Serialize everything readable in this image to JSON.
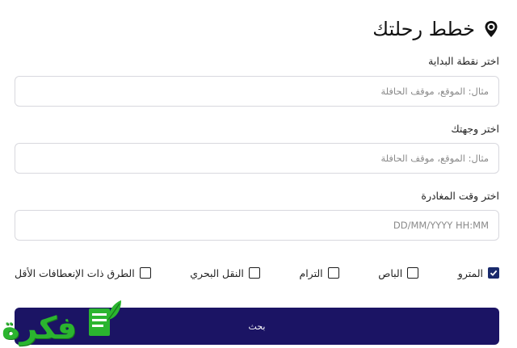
{
  "header": {
    "title": "خطط رحلتك",
    "icon": "location-pin-icon"
  },
  "form": {
    "start": {
      "label": "اختر نقطة البداية",
      "placeholder": "مثال: الموقع، موقف الحافلة",
      "value": ""
    },
    "destination": {
      "label": "اختر وجهتك",
      "placeholder": "مثال: الموقع، موقف الحافلة",
      "value": ""
    },
    "departure": {
      "label": "اختر وقت المغادرة",
      "placeholder": "DD/MM/YYYY HH:MM",
      "value": ""
    }
  },
  "options": [
    {
      "label": "المترو",
      "checked": true
    },
    {
      "label": "الباص",
      "checked": false
    },
    {
      "label": "الترام",
      "checked": false
    },
    {
      "label": "النقل البحري",
      "checked": false
    },
    {
      "label": "الطرق ذات الإنعطافات الأقل",
      "checked": false
    }
  ],
  "search_button": {
    "label": "بحث"
  },
  "watermark": {
    "text": "فكرة"
  },
  "colors": {
    "primary": "#1b1464",
    "checkbox_checked": "#1a2a6c",
    "logo_green": "#2bb52f"
  }
}
